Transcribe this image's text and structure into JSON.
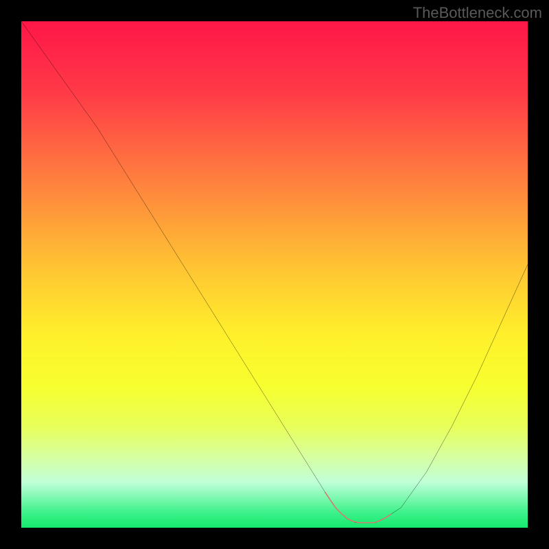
{
  "watermark": "TheBottleneck.com",
  "chart_data": {
    "type": "line",
    "title": "",
    "xlabel": "",
    "ylabel": "",
    "xlim": [
      0,
      100
    ],
    "ylim": [
      0,
      100
    ],
    "grid": false,
    "legend": false,
    "x": [
      0,
      5,
      10,
      15,
      20,
      25,
      30,
      35,
      40,
      45,
      50,
      55,
      60,
      62,
      64,
      66,
      68,
      70,
      72,
      75,
      80,
      85,
      90,
      95,
      100
    ],
    "values": [
      100,
      93,
      86,
      79,
      71,
      63,
      55,
      47,
      39,
      31,
      23,
      15,
      7,
      4,
      2,
      1,
      1,
      1,
      2,
      4,
      11,
      20,
      30,
      41,
      52
    ],
    "band": {
      "x_start": 60,
      "x_end": 73,
      "color": "#d67a72"
    },
    "gradient_stops": [
      {
        "pos": 0.0,
        "color": "#ff1648"
      },
      {
        "pos": 0.14,
        "color": "#ff3a47"
      },
      {
        "pos": 0.3,
        "color": "#ff7a3f"
      },
      {
        "pos": 0.48,
        "color": "#ffc233"
      },
      {
        "pos": 0.62,
        "color": "#fff02b"
      },
      {
        "pos": 0.72,
        "color": "#f7ff2f"
      },
      {
        "pos": 0.8,
        "color": "#e8ff5a"
      },
      {
        "pos": 0.86,
        "color": "#d6ffa0"
      },
      {
        "pos": 0.91,
        "color": "#c0ffd8"
      },
      {
        "pos": 0.97,
        "color": "#3df28a"
      },
      {
        "pos": 1.0,
        "color": "#16e86e"
      }
    ]
  }
}
